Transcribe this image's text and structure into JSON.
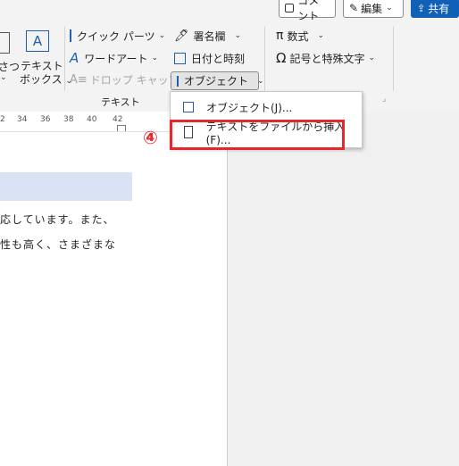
{
  "topbar": {
    "comment_label": "コメント",
    "edit_label": "編集",
    "share_label": "共有"
  },
  "ribbon": {
    "left_partial_label": "さつ",
    "textbox_label_line1": "テキスト",
    "textbox_label_line2": "ボックス",
    "quick_parts_label": "クイック パーツ",
    "wordart_label": "ワードアート",
    "dropcap_label": "ドロップ キャップ",
    "signature_label": "署名欄",
    "datetime_label": "日付と時刻",
    "object_label": "オブジェクト",
    "text_group_label": "テキスト",
    "equation_label": "数式",
    "symbol_label": "記号と特殊文字"
  },
  "ruler": {
    "numbers": [
      "2",
      "34",
      "36",
      "38",
      "40",
      "42"
    ]
  },
  "document": {
    "line1": "応しています。また、",
    "line2": "性も高く、さまざまな"
  },
  "menu": {
    "item1_label": "オブジェクト(J)...",
    "item2_label": "テキストをファイルから挿入(F)..."
  },
  "annotation": {
    "step_number": "④",
    "callout_color": "#e8262e"
  },
  "colors": {
    "accent": "#1160b8",
    "highlight": "#d9e3f3"
  }
}
